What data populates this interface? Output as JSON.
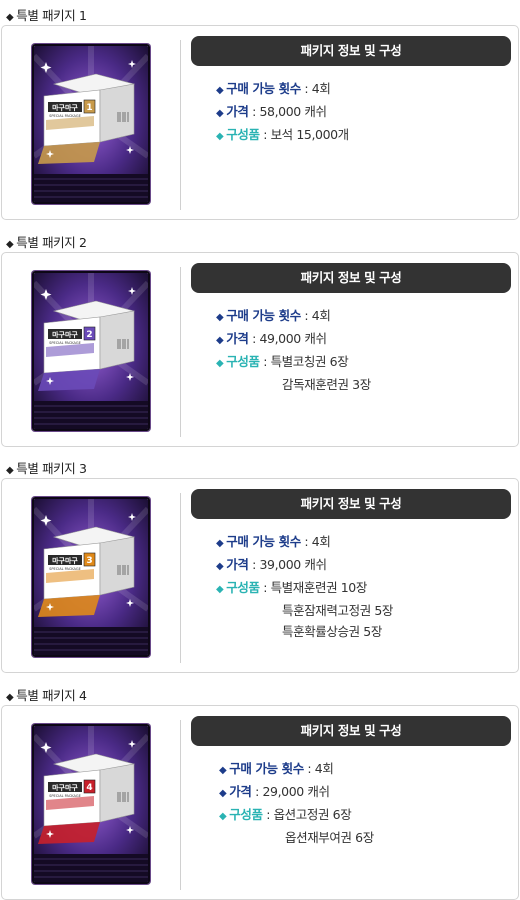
{
  "common": {
    "pill_label": "패키지 정보 및 구성",
    "count_label": "구매 가능 횟수",
    "price_label": "가격",
    "items_label": "구성품"
  },
  "colors": {
    "label_blue": "#1d3c8a",
    "label_teal": "#2ab3b3",
    "pill_bg": "#333333"
  },
  "packages": [
    {
      "title": "특별 패키지 1",
      "box_text": "마구마구",
      "box_sub": "SPECIAL PACKAGE",
      "box_number": "1",
      "accent": "#c89a4a",
      "count": ": 4회",
      "price": ": 58,000 캐쉬",
      "items": [
        ": 보석 15,000개"
      ]
    },
    {
      "title": "특별 패키지 2",
      "box_text": "마구마구",
      "box_sub": "SPECIAL PACKAGE",
      "box_number": "2",
      "accent": "#6a4ab8",
      "count": ": 4회",
      "price": ": 49,000 캐쉬",
      "items": [
        ":  특별코칭권 6장",
        "감독재훈련권 3장"
      ]
    },
    {
      "title": "특별 패키지 3",
      "box_text": "마구마구",
      "box_sub": "SPECIAL PACKAGE",
      "box_number": "3",
      "accent": "#e08a1a",
      "count": ": 4회",
      "price": ": 39,000 캐쉬",
      "items": [
        ":  특별재훈련권 10장",
        "특훈잠재력고정권 5장",
        "특훈확률상승권 5장"
      ]
    },
    {
      "title": "특별 패키지 4",
      "box_text": "마구마구",
      "box_sub": "SPECIAL PACKAGE",
      "box_number": "4",
      "accent": "#c8202a",
      "count": ": 4회",
      "price": ": 29,000 캐쉬",
      "items": [
        ":  옵션고정권 6장",
        "옵션재부여권 6장"
      ]
    }
  ]
}
